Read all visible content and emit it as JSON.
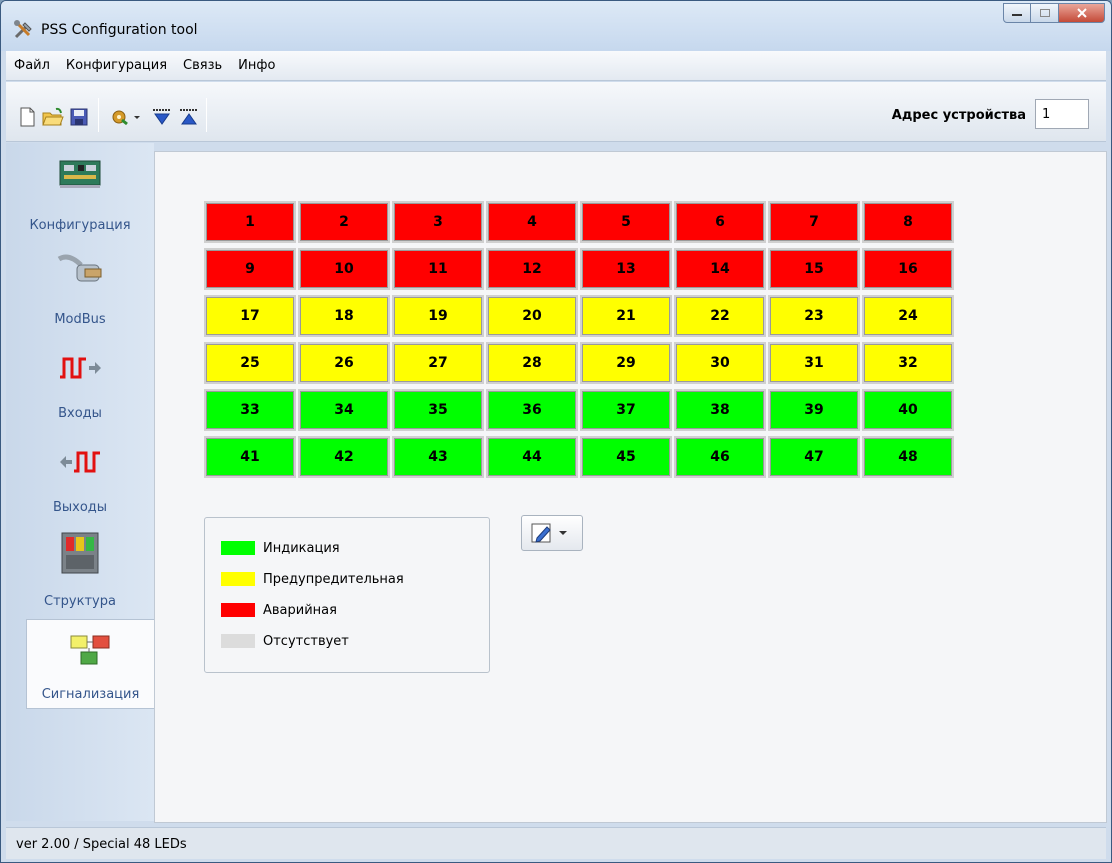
{
  "window": {
    "title": "PSS Configuration tool",
    "controls": [
      "minimize",
      "maximize",
      "close"
    ]
  },
  "menu": [
    "Файл",
    "Конфигурация",
    "Связь",
    "Инфо"
  ],
  "toolbar": {
    "buttons": [
      "new-file-icon",
      "open-folder-icon",
      "save-icon",
      "connect-icon",
      "read-down-icon",
      "write-up-icon"
    ],
    "address_label": "Адрес устройства",
    "address_value": "1"
  },
  "sidebar": {
    "items": [
      {
        "label": "Конфигурация",
        "icon": "board-icon"
      },
      {
        "label": "ModBus",
        "icon": "cable-icon"
      },
      {
        "label": "Входы",
        "icon": "input-signal-icon"
      },
      {
        "label": "Выходы",
        "icon": "output-signal-icon"
      },
      {
        "label": "Структура",
        "icon": "structure-icon"
      },
      {
        "label": "Сигнализация",
        "icon": "signaling-icon",
        "active": true
      }
    ]
  },
  "leds": {
    "colors": {
      "red": "#ff0000",
      "yellow": "#ffff00",
      "green": "#00ff00",
      "empty": "#dcdcdc"
    },
    "rows": [
      {
        "state": "red",
        "numbers": [
          "1",
          "2",
          "3",
          "4",
          "5",
          "6",
          "7",
          "8"
        ]
      },
      {
        "state": "red",
        "numbers": [
          "9",
          "10",
          "11",
          "12",
          "13",
          "14",
          "15",
          "16"
        ]
      },
      {
        "state": "yellow",
        "numbers": [
          "17",
          "18",
          "19",
          "20",
          "21",
          "22",
          "23",
          "24"
        ]
      },
      {
        "state": "yellow",
        "numbers": [
          "25",
          "26",
          "27",
          "28",
          "29",
          "30",
          "31",
          "32"
        ]
      },
      {
        "state": "green",
        "numbers": [
          "33",
          "34",
          "35",
          "36",
          "37",
          "38",
          "39",
          "40"
        ]
      },
      {
        "state": "green",
        "numbers": [
          "41",
          "42",
          "43",
          "44",
          "45",
          "46",
          "47",
          "48"
        ]
      }
    ]
  },
  "legend": [
    {
      "label": "Индикация",
      "color": "#00ff00"
    },
    {
      "label": "Предупредительная",
      "color": "#ffff00"
    },
    {
      "label": "Аварийная",
      "color": "#ff0000"
    },
    {
      "label": "Отсутствует",
      "color": "#dcdcdc"
    }
  ],
  "edit_button": {
    "icon": "edit-pencil-icon"
  },
  "status": {
    "text": "ver 2.00  /  Special 48 LEDs"
  }
}
